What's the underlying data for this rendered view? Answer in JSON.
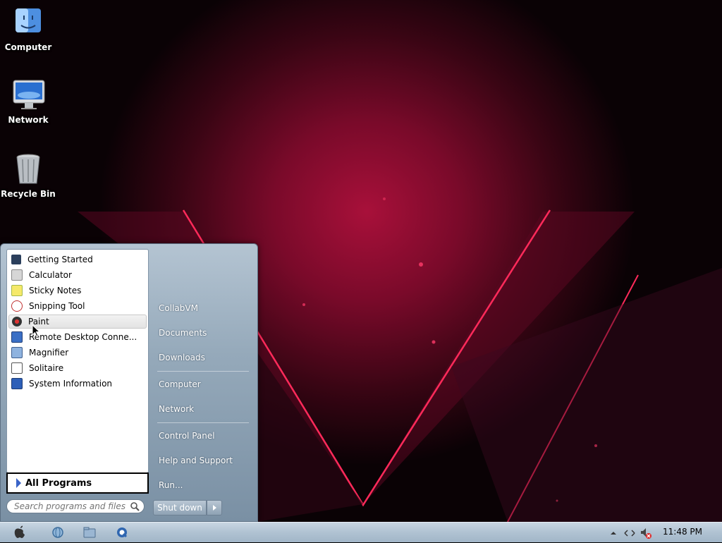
{
  "desktop": {
    "icons": [
      {
        "label": "Computer"
      },
      {
        "label": "Network"
      },
      {
        "label": "Recycle Bin"
      }
    ]
  },
  "start_menu": {
    "programs": [
      {
        "label": "Getting Started",
        "icon": "getting-started-icon"
      },
      {
        "label": "Calculator",
        "icon": "calculator-icon"
      },
      {
        "label": "Sticky Notes",
        "icon": "sticky-notes-icon"
      },
      {
        "label": "Snipping Tool",
        "icon": "snipping-tool-icon"
      },
      {
        "label": "Paint",
        "icon": "paint-icon",
        "highlighted": true
      },
      {
        "label": "Remote Desktop Conne...",
        "icon": "remote-desktop-icon"
      },
      {
        "label": "Magnifier",
        "icon": "magnifier-icon"
      },
      {
        "label": "Solitaire",
        "icon": "solitaire-icon"
      },
      {
        "label": "System Information",
        "icon": "system-information-icon"
      }
    ],
    "all_programs": "All Programs",
    "search_placeholder": "Search programs and files",
    "right_items": [
      {
        "label": "CollabVM"
      },
      {
        "label": "Documents"
      },
      {
        "label": "Downloads"
      },
      {
        "label": "Computer"
      },
      {
        "label": "Network"
      },
      {
        "label": "Control Panel"
      },
      {
        "label": "Help and Support"
      },
      {
        "label": "Run..."
      }
    ],
    "shutdown_label": "Shut down"
  },
  "taskbar": {
    "clock": "11:48 PM"
  },
  "colors": {
    "wallpaper_accent": "#a8103a",
    "taskbar": "#b0c2d2",
    "menu_highlight": "#e3e3e3"
  }
}
